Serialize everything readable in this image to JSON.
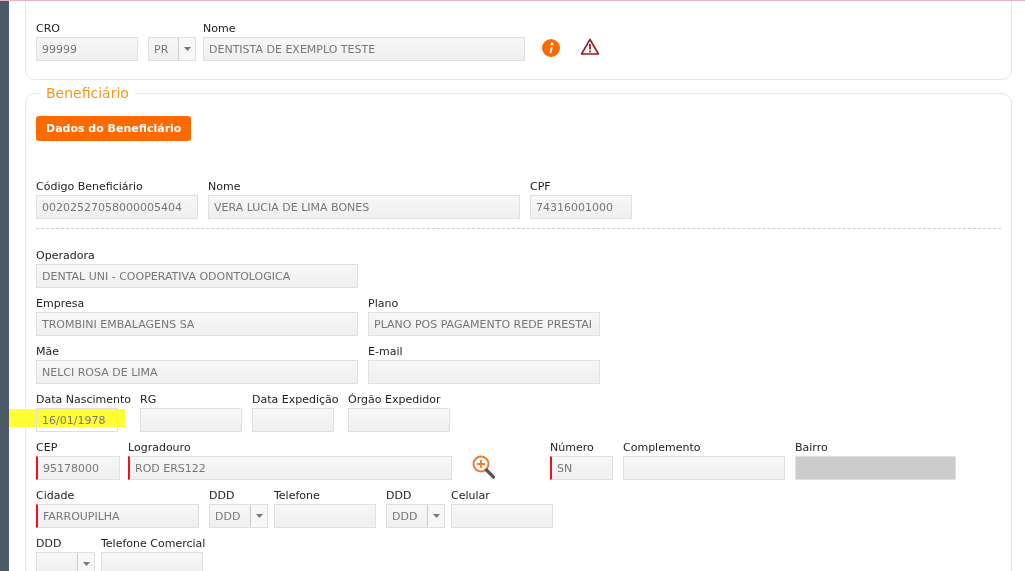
{
  "professional": {
    "rows": [
      [
        {
          "kind": "text",
          "label": "CRO",
          "value": "99999",
          "required": false,
          "disabled": false,
          "highlighted": false
        },
        {
          "kind": "select",
          "value": "PR",
          "required": false,
          "disabled": false,
          "highlighted": false
        },
        {
          "kind": "text",
          "label": "Nome",
          "value": "DENTISTA DE EXEMPLO TESTE",
          "required": false,
          "disabled": false,
          "highlighted": false
        }
      ]
    ]
  },
  "beneficiary": {
    "legend": "Beneficiário",
    "button": "Dados do Beneficiário",
    "rows": [
      [
        {
          "kind": "text",
          "label": "Código Beneficiário",
          "value": "00202527058000005404",
          "required": false,
          "disabled": false,
          "highlighted": false
        },
        {
          "kind": "text",
          "label": "Nome",
          "value": "VERA LUCIA DE LIMA BONES",
          "required": false,
          "disabled": false,
          "highlighted": false
        },
        {
          "kind": "text",
          "label": "CPF",
          "value": "74316001000",
          "required": false,
          "disabled": false,
          "highlighted": false
        }
      ],
      [
        {
          "kind": "text",
          "label": "Operadora",
          "value": "DENTAL UNI - COOPERATIVA ODONTOLOGICA",
          "required": false,
          "disabled": false,
          "highlighted": false
        }
      ],
      [
        {
          "kind": "text",
          "label": "Empresa",
          "value": "TROMBINI EMBALAGENS SA",
          "required": false,
          "disabled": false,
          "highlighted": false
        },
        {
          "kind": "text",
          "label": "Plano",
          "value": "PLANO POS PAGAMENTO REDE PRESTAI",
          "required": false,
          "disabled": false,
          "highlighted": false
        }
      ],
      [
        {
          "kind": "text",
          "label": "Mãe",
          "value": "NELCI ROSA DE LIMA",
          "required": false,
          "disabled": false,
          "highlighted": false
        },
        {
          "kind": "text",
          "label": "E-mail",
          "required": false,
          "disabled": false,
          "highlighted": false
        }
      ],
      [
        {
          "kind": "text",
          "label": "Data Nascimento",
          "value": "16/01/1978",
          "required": false,
          "disabled": false,
          "highlighted": true
        },
        {
          "kind": "text",
          "label": "RG",
          "required": false,
          "disabled": false,
          "highlighted": false
        },
        {
          "kind": "text",
          "label": "Data Expedição",
          "required": false,
          "disabled": false,
          "highlighted": false
        },
        {
          "kind": "text",
          "label": "Órgão Expedidor",
          "required": false,
          "disabled": false,
          "highlighted": false
        }
      ],
      [
        {
          "kind": "text",
          "label": "CEP",
          "value": "95178000",
          "required": true,
          "disabled": false,
          "highlighted": false
        },
        {
          "kind": "text",
          "label": "Logradouro",
          "value": "ROD ERS122",
          "required": true,
          "disabled": false,
          "highlighted": false
        },
        {
          "kind": "text",
          "label": "Número",
          "value": "SN",
          "required": true,
          "disabled": false,
          "highlighted": false
        },
        {
          "kind": "text",
          "label": "Complemento",
          "required": false,
          "disabled": false,
          "highlighted": false
        },
        {
          "kind": "text",
          "label": "Bairro",
          "required": false,
          "disabled": true,
          "highlighted": false
        }
      ],
      [
        {
          "kind": "text",
          "label": "Cidade",
          "value": "FARROUPILHA",
          "required": true,
          "disabled": false,
          "highlighted": false
        },
        {
          "kind": "select",
          "label": "DDD",
          "value": "DDD",
          "required": false,
          "disabled": false,
          "highlighted": false
        },
        {
          "kind": "text",
          "label": "Telefone",
          "required": false,
          "disabled": false,
          "highlighted": false
        },
        {
          "kind": "select",
          "label": "DDD",
          "value": "DDD",
          "required": false,
          "disabled": false,
          "highlighted": false
        },
        {
          "kind": "text",
          "label": "Celular",
          "required": false,
          "disabled": false,
          "highlighted": false
        }
      ],
      [
        {
          "kind": "select",
          "label": "DDD"
        },
        {
          "kind": "text",
          "label": "Telefone Comercial"
        }
      ]
    ]
  }
}
